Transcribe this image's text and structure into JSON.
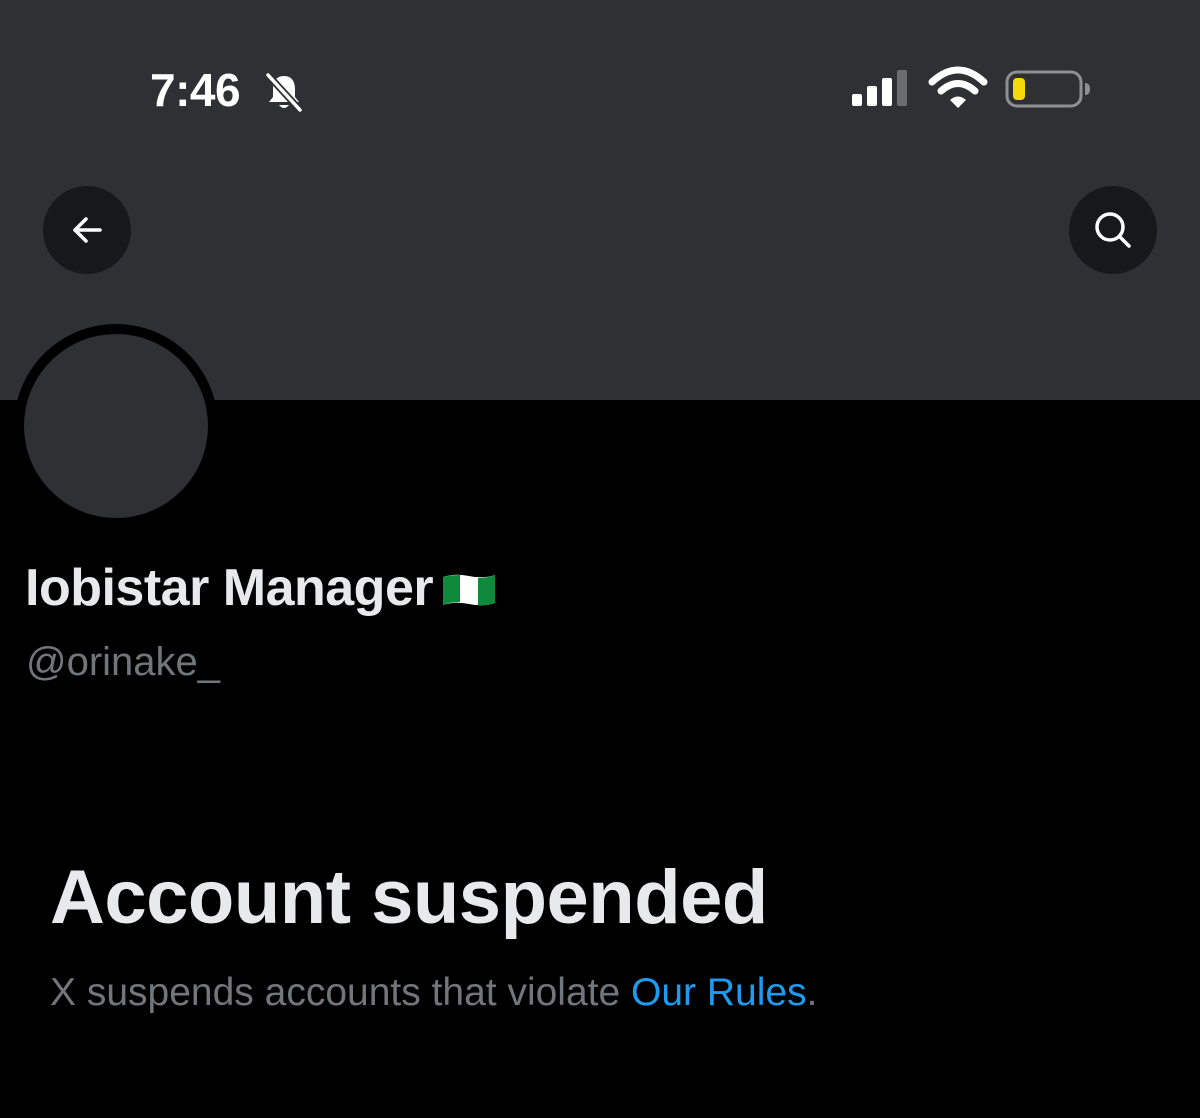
{
  "status_bar": {
    "time": "7:46",
    "icons": [
      "bell-slash-icon",
      "cellular-signal-icon",
      "wifi-icon",
      "battery-low-icon"
    ]
  },
  "header": {
    "back_icon": "arrow-left-icon",
    "search_icon": "search-icon"
  },
  "profile": {
    "display_name": "Iobistar Manager",
    "flag_icon": "nigeria-flag-icon",
    "handle": "@orinake_"
  },
  "suspension": {
    "title": "Account suspended",
    "text_before": "X suspends accounts that violate ",
    "link_label": "Our Rules",
    "text_after": "."
  },
  "colors": {
    "background": "#000000",
    "banner": "#2f3033",
    "primary_text": "#e7e9ea",
    "secondary_text": "#71767b",
    "link": "#1d9bf0",
    "battery_level": "#f5d90a"
  }
}
